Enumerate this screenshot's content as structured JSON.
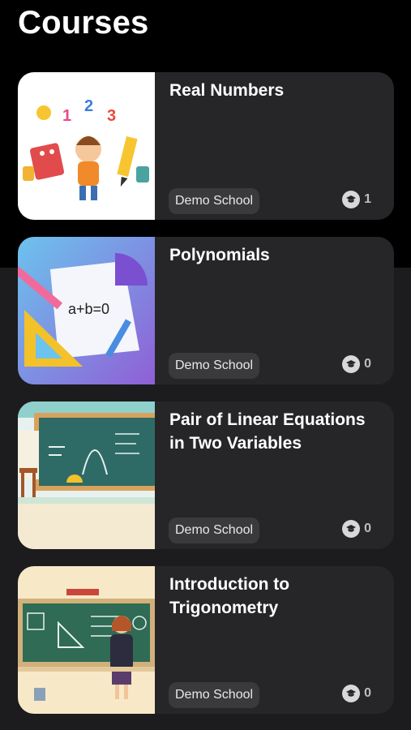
{
  "page": {
    "title": "Courses"
  },
  "courses": [
    {
      "title": "Real Numbers",
      "school": "Demo School",
      "enrolled": "1",
      "thumbnail": "kids-numbers-illustration"
    },
    {
      "title": "Polynomials",
      "school": "Demo School",
      "enrolled": "0",
      "thumbnail": "math-paper-illustration"
    },
    {
      "title": "Pair of Linear Equations in Two Variables",
      "school": "Demo School",
      "enrolled": "0",
      "thumbnail": "classroom-blackboard-illustration"
    },
    {
      "title": "Introduction to Trigonometry",
      "school": "Demo School",
      "enrolled": "0",
      "thumbnail": "teacher-trigonometry-illustration"
    }
  ],
  "icons": {
    "enroll": "graduation-cap-icon"
  },
  "colors": {
    "background_top": "#000000",
    "background_bottom": "#1c1c1e",
    "card": "#262628",
    "badge": "#3a3a3c"
  }
}
